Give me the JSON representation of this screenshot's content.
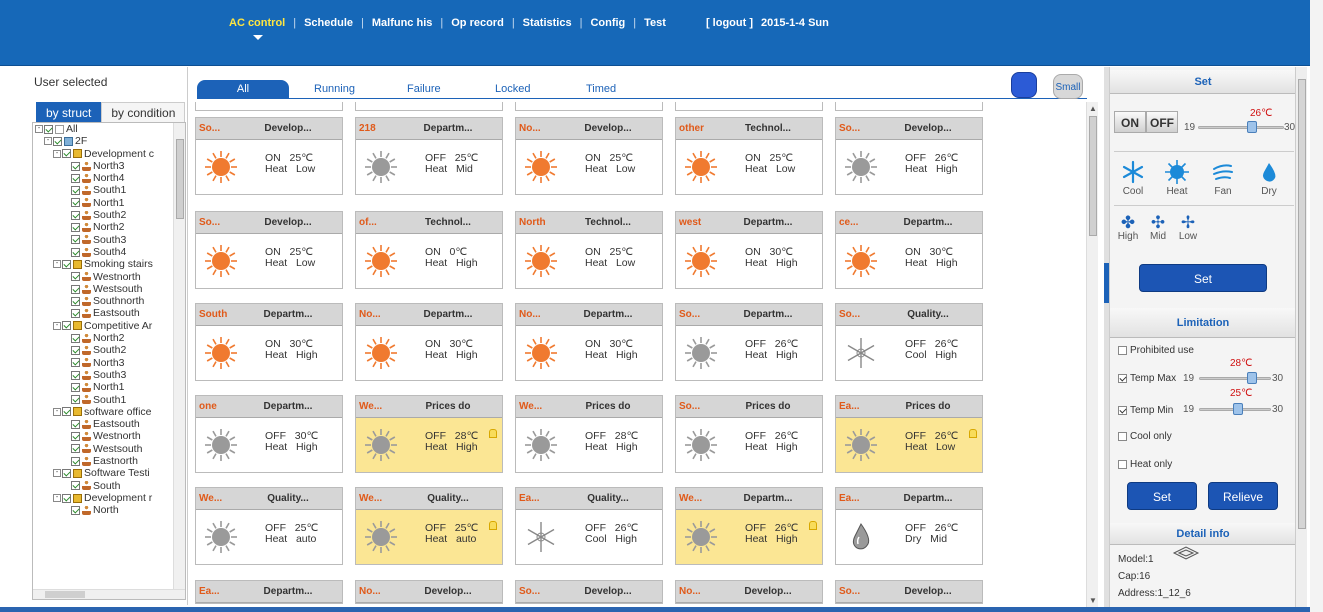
{
  "nav": {
    "items": [
      "AC control",
      "Schedule",
      "Malfunc his",
      "Op record",
      "Statistics",
      "Config",
      "Test"
    ],
    "active_index": 0,
    "logout": "[ logout ]",
    "date": "2015-1-4 Sun"
  },
  "left": {
    "title": "User selected",
    "tabs": [
      "by struct",
      "by condition"
    ],
    "tree": [
      {
        "label": "All",
        "level": 0,
        "icon": "doc",
        "toggle": "-"
      },
      {
        "label": "2F",
        "level": 1,
        "icon": "flr",
        "toggle": "-"
      },
      {
        "label": "Development c",
        "level": 2,
        "icon": "bld",
        "toggle": "-"
      },
      {
        "label": "North3",
        "level": 3,
        "icon": "usr"
      },
      {
        "label": "North4",
        "level": 3,
        "icon": "usr"
      },
      {
        "label": "South1",
        "level": 3,
        "icon": "usr"
      },
      {
        "label": "North1",
        "level": 3,
        "icon": "usr"
      },
      {
        "label": "South2",
        "level": 3,
        "icon": "usr"
      },
      {
        "label": "North2",
        "level": 3,
        "icon": "usr"
      },
      {
        "label": "South3",
        "level": 3,
        "icon": "usr"
      },
      {
        "label": "South4",
        "level": 3,
        "icon": "usr"
      },
      {
        "label": "Smoking stairs",
        "level": 2,
        "icon": "bld",
        "toggle": "-"
      },
      {
        "label": "Westnorth",
        "level": 3,
        "icon": "usr"
      },
      {
        "label": "Westsouth",
        "level": 3,
        "icon": "usr"
      },
      {
        "label": "Southnorth",
        "level": 3,
        "icon": "usr"
      },
      {
        "label": "Eastsouth",
        "level": 3,
        "icon": "usr"
      },
      {
        "label": "Competitive Ar",
        "level": 2,
        "icon": "bld",
        "toggle": "-"
      },
      {
        "label": "North2",
        "level": 3,
        "icon": "usr"
      },
      {
        "label": "South2",
        "level": 3,
        "icon": "usr"
      },
      {
        "label": "North3",
        "level": 3,
        "icon": "usr"
      },
      {
        "label": "South3",
        "level": 3,
        "icon": "usr"
      },
      {
        "label": "North1",
        "level": 3,
        "icon": "usr"
      },
      {
        "label": "South1",
        "level": 3,
        "icon": "usr"
      },
      {
        "label": "software office",
        "level": 2,
        "icon": "bld",
        "toggle": "-"
      },
      {
        "label": "Eastsouth",
        "level": 3,
        "icon": "usr"
      },
      {
        "label": "Westnorth",
        "level": 3,
        "icon": "usr"
      },
      {
        "label": "Westsouth",
        "level": 3,
        "icon": "usr"
      },
      {
        "label": "Eastnorth",
        "level": 3,
        "icon": "usr"
      },
      {
        "label": "Software Testi",
        "level": 2,
        "icon": "bld",
        "toggle": "-"
      },
      {
        "label": "South",
        "level": 3,
        "icon": "usr"
      },
      {
        "label": "Development r",
        "level": 2,
        "icon": "bld",
        "toggle": "-"
      },
      {
        "label": "North",
        "level": 3,
        "icon": "usr"
      }
    ],
    "hscroll_label": "III"
  },
  "filters": [
    "All",
    "Running",
    "Failure",
    "Locked",
    "Timed"
  ],
  "size_label": "Small",
  "cards": [
    {
      "name": "So...",
      "dept": "Develop...",
      "on": true,
      "mode": "heat",
      "state": "ON",
      "temp": "25℃",
      "modeText": "Heat",
      "fan": "Low",
      "warn": false,
      "lock": false
    },
    {
      "name": "218",
      "dept": "Departm...",
      "on": false,
      "mode": "heat",
      "state": "OFF",
      "temp": "25℃",
      "modeText": "Heat",
      "fan": "Mid",
      "warn": false,
      "lock": false
    },
    {
      "name": "No...",
      "dept": "Develop...",
      "on": true,
      "mode": "heat",
      "state": "ON",
      "temp": "25℃",
      "modeText": "Heat",
      "fan": "Low",
      "warn": false,
      "lock": false
    },
    {
      "name": "other",
      "dept": "Technol...",
      "on": true,
      "mode": "heat",
      "state": "ON",
      "temp": "25℃",
      "modeText": "Heat",
      "fan": "Low",
      "warn": false,
      "lock": false
    },
    {
      "name": "So...",
      "dept": "Develop...",
      "on": false,
      "mode": "heat",
      "state": "OFF",
      "temp": "26℃",
      "modeText": "Heat",
      "fan": "High",
      "warn": false,
      "lock": false
    },
    {
      "name": "So...",
      "dept": "Develop...",
      "on": true,
      "mode": "heat",
      "state": "ON",
      "temp": "25℃",
      "modeText": "Heat",
      "fan": "Low",
      "warn": false,
      "lock": false
    },
    {
      "name": "of...",
      "dept": "Technol...",
      "on": true,
      "mode": "heat",
      "state": "ON",
      "temp": "0℃",
      "modeText": "Heat",
      "fan": "High",
      "warn": false,
      "lock": false
    },
    {
      "name": "North",
      "dept": "Technol...",
      "on": true,
      "mode": "heat",
      "state": "ON",
      "temp": "25℃",
      "modeText": "Heat",
      "fan": "Low",
      "warn": false,
      "lock": false
    },
    {
      "name": "west",
      "dept": "Departm...",
      "on": true,
      "mode": "heat",
      "state": "ON",
      "temp": "30℃",
      "modeText": "Heat",
      "fan": "High",
      "warn": false,
      "lock": false
    },
    {
      "name": "ce...",
      "dept": "Departm...",
      "on": true,
      "mode": "heat",
      "state": "ON",
      "temp": "30℃",
      "modeText": "Heat",
      "fan": "High",
      "warn": false,
      "lock": false
    },
    {
      "name": "South",
      "dept": "Departm...",
      "on": true,
      "mode": "heat",
      "state": "ON",
      "temp": "30℃",
      "modeText": "Heat",
      "fan": "High",
      "warn": false,
      "lock": false
    },
    {
      "name": "No...",
      "dept": "Departm...",
      "on": true,
      "mode": "heat",
      "state": "ON",
      "temp": "30℃",
      "modeText": "Heat",
      "fan": "High",
      "warn": false,
      "lock": false
    },
    {
      "name": "No...",
      "dept": "Departm...",
      "on": true,
      "mode": "heat",
      "state": "ON",
      "temp": "30℃",
      "modeText": "Heat",
      "fan": "High",
      "warn": false,
      "lock": false
    },
    {
      "name": "So...",
      "dept": "Departm...",
      "on": false,
      "mode": "heat",
      "state": "OFF",
      "temp": "26℃",
      "modeText": "Heat",
      "fan": "High",
      "warn": false,
      "lock": false
    },
    {
      "name": "So...",
      "dept": "Quality...",
      "on": false,
      "mode": "cool",
      "state": "OFF",
      "temp": "26℃",
      "modeText": "Cool",
      "fan": "High",
      "warn": false,
      "lock": false
    },
    {
      "name": "one",
      "dept": "Departm...",
      "on": false,
      "mode": "heat",
      "state": "OFF",
      "temp": "30℃",
      "modeText": "Heat",
      "fan": "High",
      "warn": false,
      "lock": false
    },
    {
      "name": "We...",
      "dept": "Prices do",
      "on": false,
      "mode": "heat",
      "state": "OFF",
      "temp": "28℃",
      "modeText": "Heat",
      "fan": "High",
      "warn": true,
      "lock": true
    },
    {
      "name": "We...",
      "dept": "Prices do",
      "on": false,
      "mode": "heat",
      "state": "OFF",
      "temp": "28℃",
      "modeText": "Heat",
      "fan": "High",
      "warn": false,
      "lock": false
    },
    {
      "name": "So...",
      "dept": "Prices do",
      "on": false,
      "mode": "heat",
      "state": "OFF",
      "temp": "26℃",
      "modeText": "Heat",
      "fan": "High",
      "warn": false,
      "lock": false
    },
    {
      "name": "Ea...",
      "dept": "Prices do",
      "on": false,
      "mode": "heat",
      "state": "OFF",
      "temp": "26℃",
      "modeText": "Heat",
      "fan": "Low",
      "warn": true,
      "lock": true
    },
    {
      "name": "We...",
      "dept": "Quality...",
      "on": false,
      "mode": "heat",
      "state": "OFF",
      "temp": "25℃",
      "modeText": "Heat",
      "fan": "auto",
      "warn": false,
      "lock": false
    },
    {
      "name": "We...",
      "dept": "Quality...",
      "on": false,
      "mode": "heat",
      "state": "OFF",
      "temp": "25℃",
      "modeText": "Heat",
      "fan": "auto",
      "warn": true,
      "lock": true
    },
    {
      "name": "Ea...",
      "dept": "Quality...",
      "on": false,
      "mode": "cool",
      "state": "OFF",
      "temp": "26℃",
      "modeText": "Cool",
      "fan": "High",
      "warn": false,
      "lock": false
    },
    {
      "name": "We...",
      "dept": "Departm...",
      "on": false,
      "mode": "heat",
      "state": "OFF",
      "temp": "26℃",
      "modeText": "Heat",
      "fan": "High",
      "warn": true,
      "lock": true
    },
    {
      "name": "Ea...",
      "dept": "Departm...",
      "on": false,
      "mode": "dry",
      "state": "OFF",
      "temp": "26℃",
      "modeText": "Dry",
      "fan": "Mid",
      "warn": false,
      "lock": false
    },
    {
      "name": "Ea...",
      "dept": "Departm...",
      "partial": true
    },
    {
      "name": "No...",
      "dept": "Develop...",
      "partial": true
    },
    {
      "name": "So...",
      "dept": "Develop...",
      "partial": true
    },
    {
      "name": "No...",
      "dept": "Develop...",
      "partial": true
    },
    {
      "name": "So...",
      "dept": "Develop...",
      "partial": true
    }
  ],
  "set_panel": {
    "title": "Set",
    "on": "ON",
    "off": "OFF",
    "temp": "26℃",
    "min": "19",
    "max": "30",
    "temp_level": 0.64,
    "modes": [
      "Cool",
      "Heat",
      "Fan",
      "Dry"
    ],
    "fans": [
      "High",
      "Mid",
      "Low"
    ],
    "set_btn": "Set"
  },
  "limitation": {
    "title": "Limitation",
    "prohibited": "Prohibited use",
    "temp_max_label": "Temp Max",
    "temp_max_val": "28℃",
    "temp_max_level": 0.78,
    "temp_min_label": "Temp Min",
    "temp_min_val": "25℃",
    "temp_min_level": 0.55,
    "range_min": "19",
    "range_max": "30",
    "cool_only": "Cool only",
    "heat_only": "Heat only",
    "set_btn": "Set",
    "relieve_btn": "Relieve"
  },
  "detail": {
    "title": "Detail info",
    "model": "Model:1",
    "cap": "Cap:16",
    "address": "Address:1_12_6"
  },
  "colors": {
    "brand": "#1668b8",
    "active_nav": "#ffe640",
    "warn": "#fbe694",
    "sun_on": "#f07a30",
    "sun_off": "#9a9a9a"
  }
}
